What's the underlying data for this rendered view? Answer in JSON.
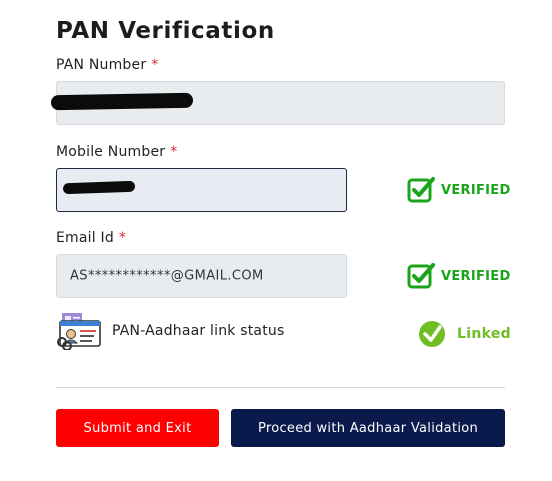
{
  "page": {
    "title": "PAN Verification"
  },
  "pan": {
    "label": "PAN Number",
    "required_mark": "*"
  },
  "mobile": {
    "label": "Mobile Number",
    "required_mark": "*",
    "status": "VERIFIED"
  },
  "email": {
    "label": "Email Id",
    "required_mark": "*",
    "value": "AS************@GMAIL.COM",
    "status": "VERIFIED"
  },
  "link_status": {
    "label": "PAN-Aadhaar link status",
    "status": "Linked"
  },
  "actions": {
    "submit_label": "Submit and Exit",
    "proceed_label": "Proceed with Aadhaar Validation"
  },
  "colors": {
    "verified": "#1aa41a",
    "linked": "#6fbe24",
    "submit_bg": "#ff0000",
    "proceed_bg": "#0b1a4d",
    "required": "#e0262d"
  },
  "icons": [
    "verified-check-icon",
    "linked-check-icon",
    "id-card-link-icon"
  ]
}
